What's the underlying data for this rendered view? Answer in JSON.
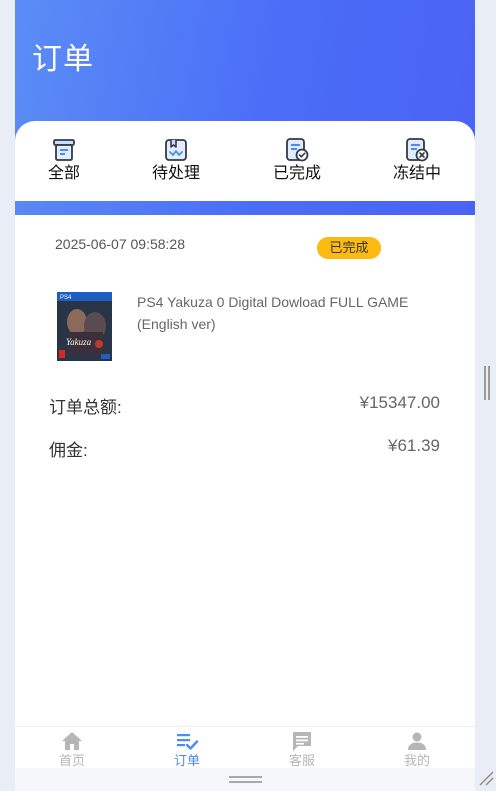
{
  "header": {
    "title": "订单"
  },
  "tabs": [
    {
      "label": "全部",
      "icon": "all-orders-icon"
    },
    {
      "label": "待处理",
      "icon": "pending-icon"
    },
    {
      "label": "已完成",
      "icon": "completed-icon"
    },
    {
      "label": "冻结中",
      "icon": "frozen-icon"
    }
  ],
  "order": {
    "time": "2025-06-07 09:58:28",
    "status": "已完成",
    "product_name": "PS4 Yakuza 0 Digital Dowload FULL GAME (English ver)",
    "thumb_brand": "PS4",
    "thumb_title": "Yakuza",
    "total_label": "订单总额:",
    "total_value": "¥15347.00",
    "commission_label": "佣金:",
    "commission_value": "¥61.39"
  },
  "tabbar": [
    {
      "label": "首页",
      "icon": "home-icon",
      "active": false
    },
    {
      "label": "订单",
      "icon": "order-list-icon",
      "active": true
    },
    {
      "label": "客服",
      "icon": "chat-icon",
      "active": false
    },
    {
      "label": "我的",
      "icon": "user-icon",
      "active": false
    }
  ],
  "colors": {
    "header_gradient_start": "#5b8df6",
    "header_gradient_end": "#4b63f5",
    "status_badge": "#fdbb12",
    "active_tab": "#4a8bf7",
    "icon_dark": "#2f3a4a",
    "icon_inactive": "#b6b6b6"
  }
}
